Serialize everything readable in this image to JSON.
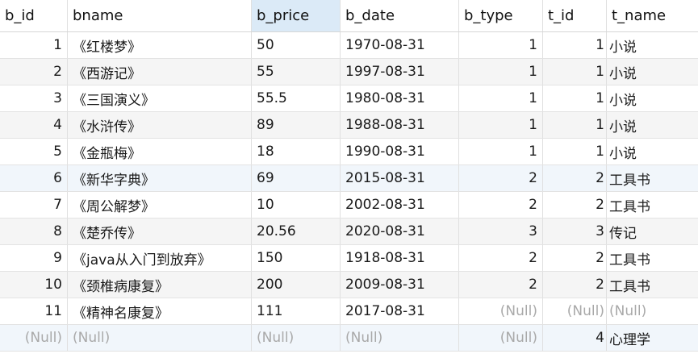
{
  "columns": [
    "b_id",
    "bname",
    "b_price",
    "b_date",
    "b_type",
    "t_id",
    "t_name"
  ],
  "rows": [
    [
      "1",
      "《红楼梦》",
      "50",
      "1970-08-31",
      "1",
      "1",
      "小说"
    ],
    [
      "2",
      "《西游记》",
      "55",
      "1997-08-31",
      "1",
      "1",
      "小说"
    ],
    [
      "3",
      "《三国演义》",
      "55.5",
      "1980-08-31",
      "1",
      "1",
      "小说"
    ],
    [
      "4",
      "《水浒传》",
      "89",
      "1988-08-31",
      "1",
      "1",
      "小说"
    ],
    [
      "5",
      "《金瓶梅》",
      "18",
      "1990-08-31",
      "1",
      "1",
      "小说"
    ],
    [
      "6",
      "《新华字典》",
      "69",
      "2015-08-31",
      "2",
      "2",
      "工具书"
    ],
    [
      "7",
      "《周公解梦》",
      "10",
      "2002-08-31",
      "2",
      "2",
      "工具书"
    ],
    [
      "8",
      "《楚乔传》",
      "20.56",
      "2020-08-31",
      "3",
      "3",
      "传记"
    ],
    [
      "9",
      "《java从入门到放弃》",
      "150",
      "1918-08-31",
      "2",
      "2",
      "工具书"
    ],
    [
      "10",
      "《颈椎病康复》",
      "200",
      "2009-08-31",
      "2",
      "2",
      "工具书"
    ],
    [
      "11",
      "《精神名康复》",
      "111",
      "2017-08-31",
      "(Null)",
      "(Null)",
      "(Null)"
    ],
    [
      "(Null)",
      "(Null)",
      "(Null)",
      "(Null)",
      "(Null)",
      "4",
      "心理学"
    ]
  ]
}
